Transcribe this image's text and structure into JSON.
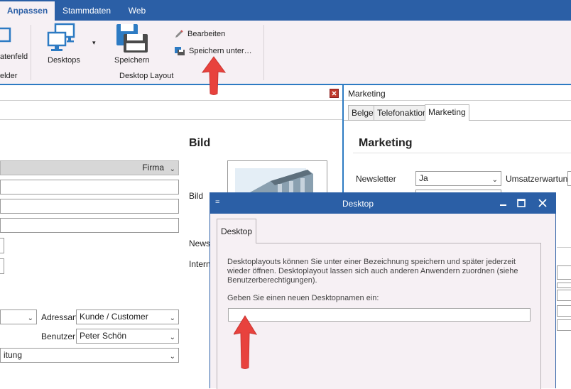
{
  "ribbon": {
    "tabs": [
      "Anpassen",
      "Stammdaten",
      "Web"
    ],
    "datenfeld_label": "atenfeld",
    "felder_group": "elder",
    "desktops_label": "Desktops",
    "speichern_label": "Speichern",
    "bearbeiten_label": "Bearbeiten",
    "speichern_unter_label": "Speichern unter…",
    "desktop_layout_group": "Desktop Layout"
  },
  "left_panel": {
    "bild_heading": "Bild",
    "firma_value": "Firma",
    "bild_label": "Bild",
    "newsl_label": "Newsl",
    "interne_label": "Interne",
    "adressart_label": "Adressart",
    "adressart_value": "Kunde / Customer",
    "benutzer_label": "Benutzer",
    "benutzer_value": "Peter Schön",
    "bottom_value": "itung"
  },
  "right_panel": {
    "header_title": "Marketing",
    "tabs": [
      "Belge",
      "Telefonaktion",
      "Marketing"
    ],
    "heading": "Marketing",
    "newsletter_label": "Newsletter",
    "newsletter_value": "Ja",
    "umsatz_label": "Umsatzerwartung"
  },
  "dialog": {
    "title": "Desktop",
    "menu_glyph": "=",
    "tab_label": "Desktop",
    "description": "Desktoplayouts können Sie unter einer Bezeichnung speichern und später jederzeit wieder öffnen. Desktoplayout lassen sich auch anderen Anwendern zuordnen (siehe Benutzerberechtigungen).",
    "prompt": "Geben Sie einen neuen Desktopnamen ein:",
    "input_value": ""
  },
  "colors": {
    "accent": "#2b5fa6",
    "arrow": "#e8423d",
    "ribbon_bg": "#f6f0f4"
  }
}
